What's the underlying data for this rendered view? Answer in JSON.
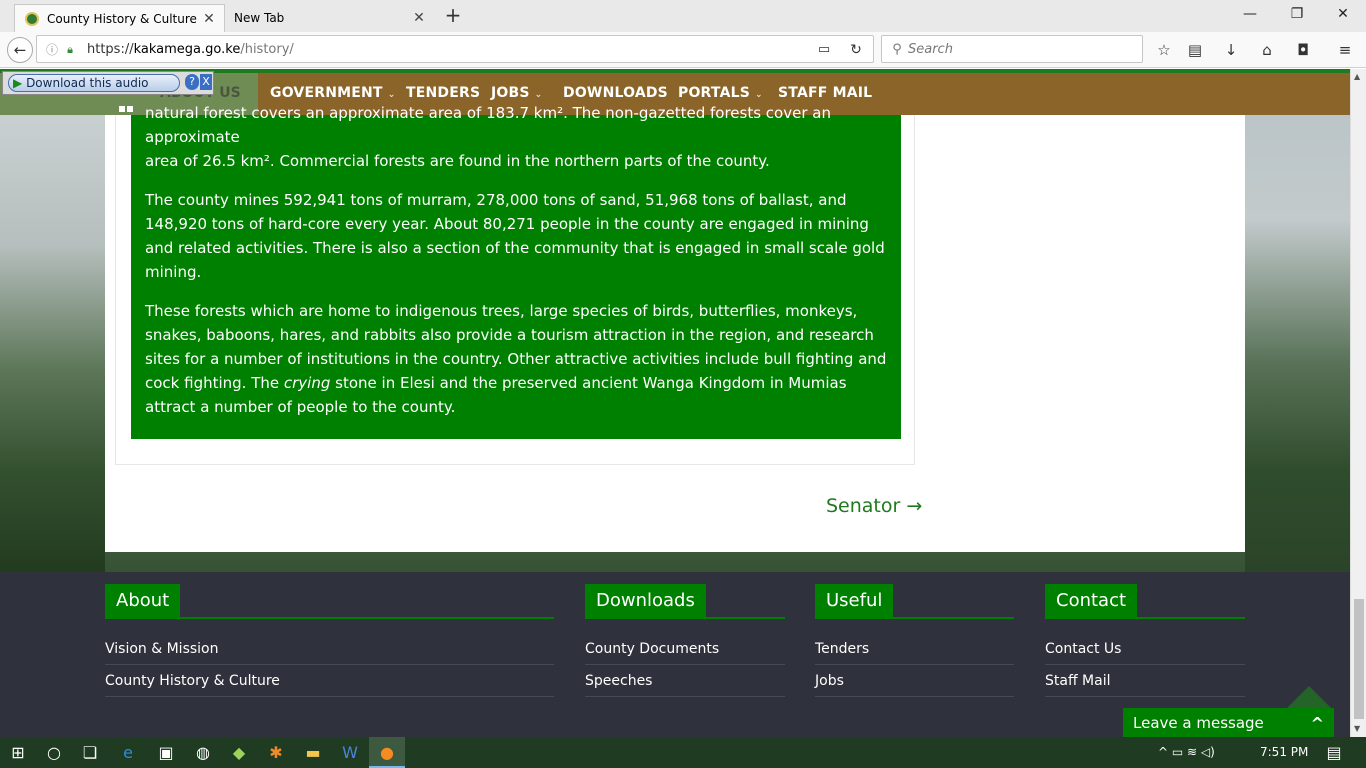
{
  "browser": {
    "tabs": [
      {
        "label": "County History & Culture ..."
      },
      {
        "label": "New Tab"
      }
    ],
    "new_tab": "+",
    "window_controls": {
      "minimize": "—",
      "restore": "❐",
      "close": "✕"
    },
    "url": {
      "scheme": "https://",
      "host": "kakamega.go.ke",
      "path": "/history/"
    },
    "search_placeholder": "Search"
  },
  "audio_widget": {
    "label": "Download this audio",
    "help": "?",
    "close": "X"
  },
  "topnav": {
    "ghost_label": "ABOUT US",
    "items": [
      {
        "label": "GOVERNMENT",
        "caret": "⌄"
      },
      {
        "label": "TENDERS"
      },
      {
        "label": "JOBS",
        "caret": "⌄"
      },
      {
        "label": "DOWNLOADS"
      },
      {
        "label": "PORTALS",
        "caret": "⌄"
      },
      {
        "label": "STAFF MAIL"
      }
    ]
  },
  "article": {
    "p0_line1": "natural forest covers an approximate area of 183.7 km². The non-gazetted forests cover an approximate",
    "p0_line2": "area of 26.5 km². Commercial forests are found in the northern parts of the county.",
    "p1": "The county mines 592,941 tons of murram, 278,000 tons of sand, 51,968 tons of ballast, and 148,920 tons of hard-core every year. About 80,271 people in the county are engaged in mining and related activities. There is also a section of the community that is engaged in small scale gold mining.",
    "p2_before": "These forests which are home to indigenous trees, large species of birds, butterflies, monkeys, snakes, baboons, hares, and rabbits also provide a tourism attraction in the region, and research sites for a number of institutions in the country. Other attractive activities include bull fighting and cock fighting. The ",
    "p2_em": "crying",
    "p2_after": " stone in Elesi and the preserved ancient Wanga Kingdom in Mumias attract a number of people to the county."
  },
  "next_link": "Senator →",
  "footer": {
    "about": {
      "heading": "About",
      "links": [
        "Vision & Mission",
        "County History & Culture"
      ]
    },
    "downloads": {
      "heading": "Downloads",
      "links": [
        "County Documents",
        "Speeches"
      ]
    },
    "useful": {
      "heading": "Useful",
      "links": [
        "Tenders",
        "Jobs"
      ]
    },
    "contact": {
      "heading": "Contact",
      "links": [
        "Contact Us",
        "Staff Mail"
      ]
    }
  },
  "chat": {
    "label": "Leave a message",
    "caret": "^"
  },
  "taskbar": {
    "clock": "7:51 PM",
    "tray": "^  ▭  ≋  ◁)"
  },
  "colors": {
    "brand_green": "#008000",
    "nav_brown": "#8a6428",
    "footer_bg": "#2f313c"
  }
}
